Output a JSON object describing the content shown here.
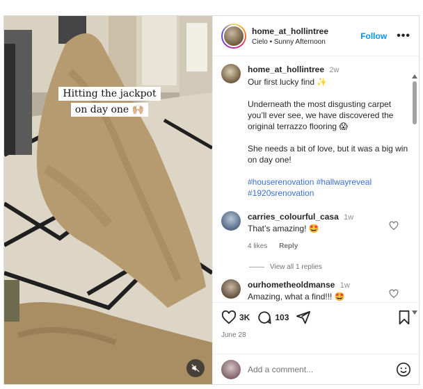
{
  "video": {
    "overlay_text": "Hitting the jackpot on day one 🙌🏼",
    "mute_icon": "speaker-muted-icon"
  },
  "header": {
    "username": "home_at_hollintree",
    "subline": "Cielo • Sunny Afternoon",
    "follow_label": "Follow",
    "more_label": "•••"
  },
  "post": {
    "username": "home_at_hollintree",
    "time": "2w",
    "paragraphs": [
      "Our first lucky find ✨",
      "Underneath the most disgusting carpet you’ll ever see, we have discovered the original terrazzo flooring 😱",
      "She needs a bit of love, but it was a big win on day one!"
    ],
    "hashtags_line1": "#houserenovation #hallwayreveal",
    "hashtags_line2": "#1920srenovation"
  },
  "comments": [
    {
      "username": "carries_colourful_casa",
      "time": "1w",
      "text": "That’s amazing! 🤩",
      "likes": "4 likes",
      "reply_label": "Reply",
      "view_replies": "View all 1 replies"
    },
    {
      "username": "ourhometheoldmanse",
      "time": "1w",
      "text": "Amazing, what a find!!! 🤩"
    }
  ],
  "actions": {
    "like_count": "3K",
    "comment_count": "103",
    "date": "June 28"
  },
  "add_comment": {
    "placeholder": "Add a comment..."
  },
  "colors": {
    "accent": "#0095f6",
    "hashtag": "#3b6fd1",
    "muted_text": "#737373"
  }
}
